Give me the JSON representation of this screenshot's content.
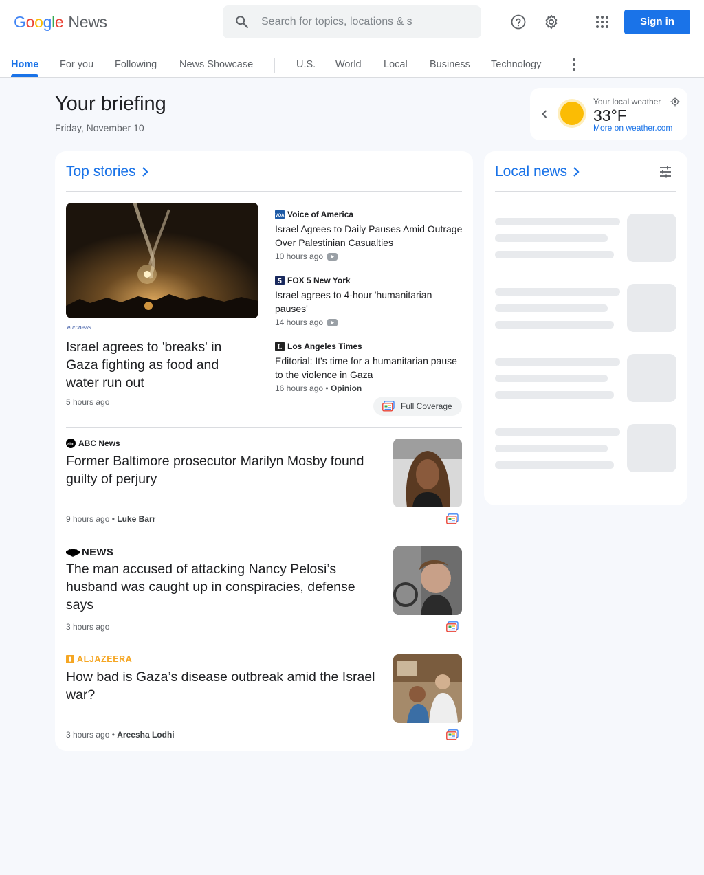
{
  "header": {
    "logo": {
      "g1": "G",
      "g2": "o",
      "g3": "o",
      "g4": "g",
      "g5": "l",
      "g6": "e",
      "news": "News"
    },
    "search_placeholder": "Search for topics, locations & s",
    "sign_in": "Sign in"
  },
  "nav": {
    "tabs": [
      "Home",
      "For you",
      "Following",
      "News Showcase"
    ],
    "sections": [
      "U.S.",
      "World",
      "Local",
      "Business",
      "Technology"
    ]
  },
  "briefing": {
    "title": "Your briefing",
    "date": "Friday, November 10"
  },
  "weather": {
    "label": "Your local weather",
    "temp": "33°F",
    "link": "More on weather.com"
  },
  "top_stories": {
    "title": "Top stories",
    "hero": {
      "publisher": "euronews.",
      "title": "Israel agrees to 'breaks' in Gaza fighting as food and water run out",
      "time": "5 hours ago"
    },
    "related": [
      {
        "publisher": "Voice of America",
        "title": "Israel Agrees to Daily Pauses Amid Outrage Over Palestinian Casualties",
        "time": "10 hours ago"
      },
      {
        "publisher": "FOX 5 New York",
        "title": "Israel agrees to 4-hour 'humanitarian pauses'",
        "time": "14 hours ago"
      },
      {
        "publisher": "Los Angeles Times",
        "title": "Editorial: It's time for a humanitarian pause to the violence in Gaza",
        "time": "16 hours ago",
        "tag": "Opinion"
      }
    ],
    "full_coverage": "Full Coverage",
    "stories": [
      {
        "publisher": "ABC News",
        "title": "Former Baltimore prosecutor Marilyn Mosby found guilty of perjury",
        "time": "9 hours ago",
        "author": "Luke Barr"
      },
      {
        "publisher": "NEWS",
        "title": "The man accused of attacking Nancy Pelosi’s husband was caught up in conspiracies, defense says",
        "time": "3 hours ago"
      },
      {
        "publisher": "ALJAZEERA",
        "title": "How bad is Gaza’s disease outbreak amid the Israel war?",
        "time": "3 hours ago",
        "author": "Areesha Lodhi"
      }
    ]
  },
  "local_news": {
    "title": "Local news"
  },
  "colors": {
    "accent": "#1a73e8",
    "background": "#f6f8fc",
    "skeleton": "#e8eaed"
  }
}
